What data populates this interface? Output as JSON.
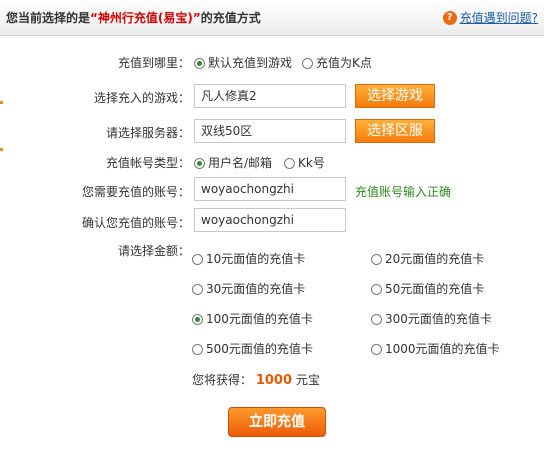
{
  "header": {
    "title_prefix": "您当前选择的是",
    "title_brand": "“神州行充值(易宝)”",
    "title_suffix": "的充值方式",
    "help_link": "充值遇到问题?"
  },
  "form": {
    "recharge_target": {
      "label": "充值到哪里：",
      "options": [
        "默认充值到游戏",
        "充值为K点"
      ],
      "selected": "默认充值到游戏"
    },
    "game": {
      "label": "选择充入的游戏：",
      "value": "凡人修真2",
      "button": "选择游戏"
    },
    "server": {
      "label": "请选择服务器：",
      "value": "双线50区",
      "button": "选择区服"
    },
    "account_type": {
      "label": "充值帐号类型：",
      "options": [
        "用户名/邮箱",
        "Kk号"
      ],
      "selected": "用户名/邮箱"
    },
    "account": {
      "label": "您需要充值的账号：",
      "value": "woyaochongzhi",
      "status": "充值账号输入正确",
      "status_color": "#2f8a22"
    },
    "confirm_account": {
      "label": "确认您充值的账号：",
      "value": "woyaochongzhi"
    },
    "amount": {
      "label": "请选择金额：",
      "options": [
        "10元面值的充值卡",
        "20元面值的充值卡",
        "30元面值的充值卡",
        "50元面值的充值卡",
        "100元面值的充值卡",
        "300元面值的充值卡",
        "500元面值的充值卡",
        "1000元面值的充值卡"
      ],
      "selected": "100元面值的充值卡"
    },
    "reward": {
      "prefix": "您将获得：",
      "amount": "1000",
      "unit": "元宝"
    },
    "submit": "立即充值"
  },
  "colors": {
    "accent": "#f47b0c",
    "brand_red": "#d60000",
    "link": "#1a5ea8",
    "amount": "#e55a00"
  }
}
